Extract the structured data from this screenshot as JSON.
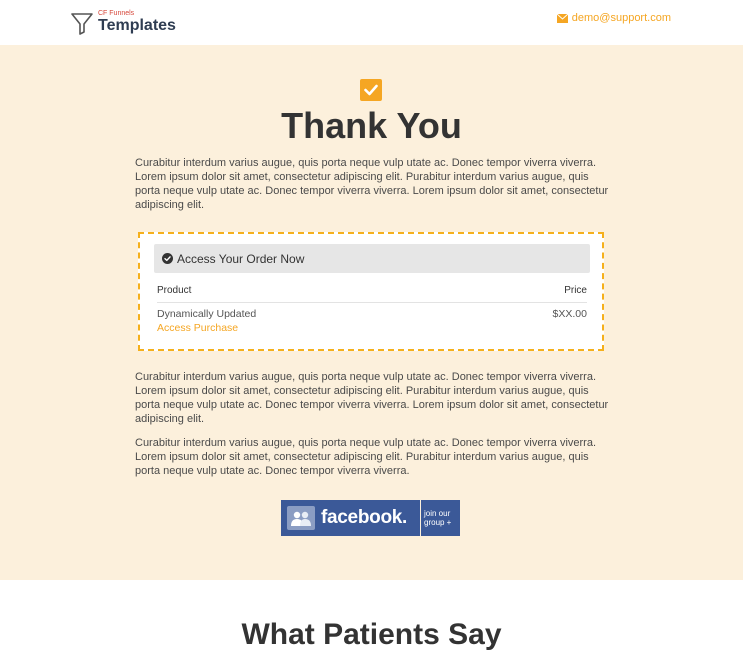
{
  "header": {
    "logo_small": "CF Funnels",
    "logo_big": "Templates",
    "email": "demo@support.com"
  },
  "hero": {
    "title": "Thank You",
    "intro": "Curabitur interdum varius augue, quis porta neque vulp utate ac. Donec tempor viverra viverra. Lorem ipsum dolor sit amet, consectetur adipiscing elit. Purabitur interdum varius augue, quis porta neque vulp utate ac. Donec tempor viverra viverra. Lorem ipsum dolor sit amet, consectetur adipiscing elit."
  },
  "order": {
    "header": "Access Your Order Now",
    "col_product": "Product",
    "col_price": "Price",
    "product_name": "Dynamically Updated",
    "product_price": "$XX.00",
    "access_link": "Access Purchase"
  },
  "body": {
    "para1": "Curabitur interdum varius augue, quis porta neque vulp utate ac. Donec tempor viverra viverra. Lorem ipsum dolor sit amet, consectetur adipiscing elit. Purabitur interdum varius augue, quis porta neque vulp utate ac. Donec tempor viverra viverra. Lorem ipsum dolor sit amet, consectetur adipiscing elit.",
    "para2": "Curabitur interdum varius augue, quis porta neque vulp utate ac. Donec tempor viverra viverra. Lorem ipsum dolor sit amet, consectetur adipiscing elit. Purabitur interdum varius augue, quis porta neque vulp utate ac. Donec tempor viverra viverra."
  },
  "facebook": {
    "word": "facebook.",
    "join": "join our group +"
  },
  "testimonials": {
    "title": "What Patients Say"
  },
  "colors": {
    "accent": "#f5a623",
    "hero_bg": "#fcf0dc",
    "facebook_blue": "#3b5998"
  }
}
